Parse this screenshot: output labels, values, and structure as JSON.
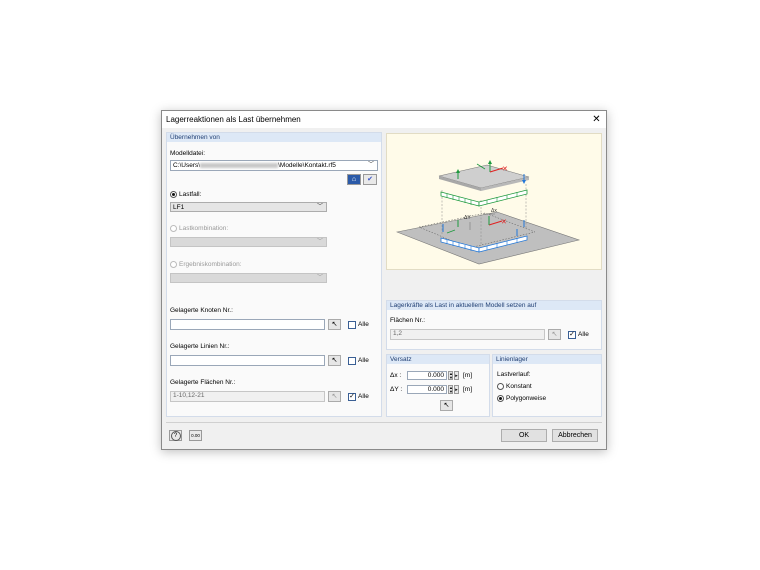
{
  "window": {
    "title": "Lagerreaktionen als Last übernehmen",
    "close_glyph": "✕"
  },
  "source": {
    "header": "Übernehmen von",
    "model_file_label": "Modelldatei:",
    "model_file_prefix": "C:\\Users\\",
    "model_file_suffix": "\\Modelle\\Kontakt.rf5",
    "load_case_label": "Lastfall:",
    "load_case_value": "LF1",
    "load_combination_label": "Lastkombination:",
    "result_combination_label": "Ergebniskombination:",
    "nodes_label": "Gelagerte Knoten Nr.:",
    "lines_label": "Gelagerte Linien Nr.:",
    "surfaces_label": "Gelagerte Flächen Nr.:",
    "surfaces_value": "1-10,12-21",
    "all_label": "Alle"
  },
  "target": {
    "header": "Lagerkräfte als Last in aktuellem Modell setzen auf",
    "surfaces_label": "Flächen Nr.:",
    "surfaces_value": "1,2",
    "all_label": "Alle"
  },
  "offset": {
    "header": "Versatz",
    "dx_label": "Δx :",
    "dx_value": "0.000",
    "dy_label": "ΔY :",
    "dy_value": "0.000",
    "unit": "[m]"
  },
  "line_support": {
    "header": "Linienlager",
    "distribution_label": "Lastverlauf:",
    "option_constant": "Konstant",
    "option_polygonal": "Polygonweise"
  },
  "buttons": {
    "ok": "OK",
    "cancel": "Abbrechen",
    "help_glyph": "?",
    "value_glyph": "0.00"
  },
  "diagram": {
    "dx": "Δx",
    "dy": "ΔY"
  },
  "colors": {
    "panel_header": "#dde8f6",
    "green": "#1e9a3e",
    "blue": "#2277d8",
    "red": "#e02020"
  }
}
